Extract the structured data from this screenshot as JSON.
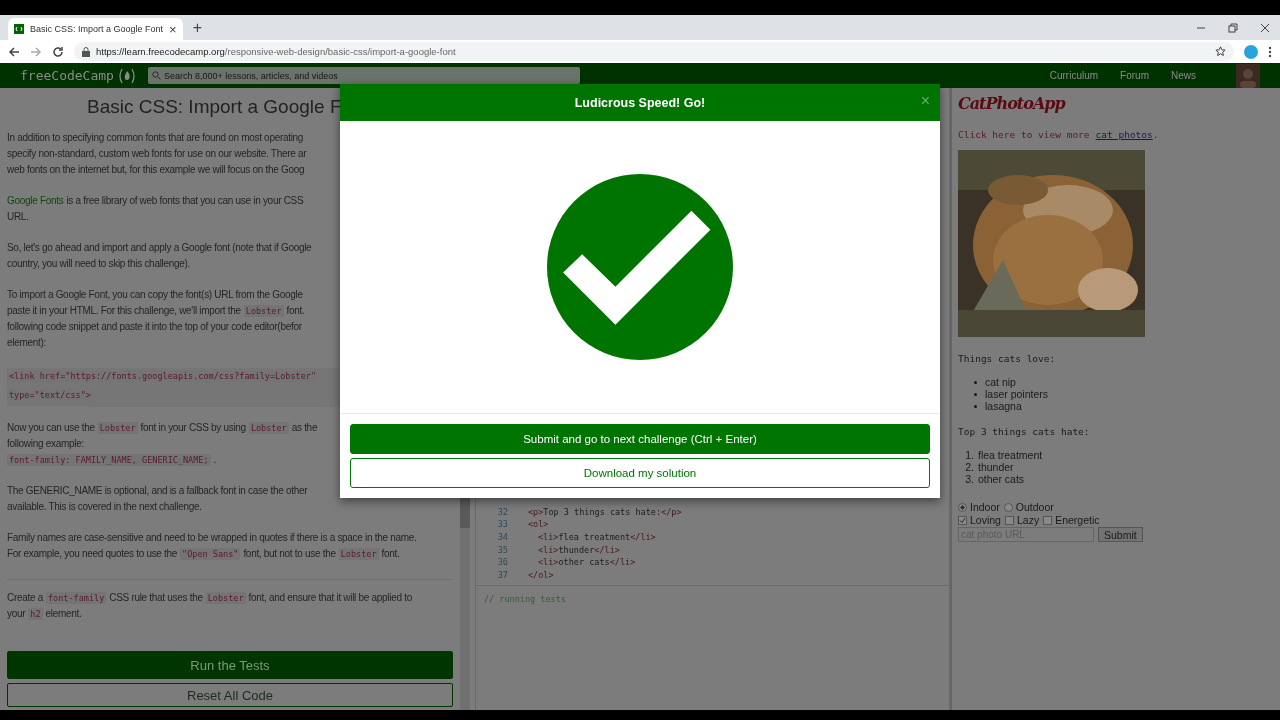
{
  "browser": {
    "tab_title": "Basic CSS: Import a Google Font",
    "tab_close": "×",
    "new_tab": "+",
    "url_host": "https://learn.freecodecamp.org",
    "url_path": "/responsive-web-design/basic-css/import-a-google-font"
  },
  "nav": {
    "logo": "freeCodeCamp",
    "search_placeholder": "Search 8,000+ lessons, articles, and videos",
    "links": [
      "Curriculum",
      "Forum",
      "News"
    ]
  },
  "lesson": {
    "title": "Basic CSS: Import a Google F",
    "paragraphs": [
      {
        "kind": "text",
        "lines": [
          [
            {
              "kind": "text",
              "text": "In addition to specifying common fonts that are found on most operating"
            }
          ],
          [
            {
              "kind": "text",
              "text": "specify non-standard, custom web fonts for use on our website. There ar"
            }
          ],
          [
            {
              "kind": "text",
              "text": "web fonts on the internet but, for this example we will focus on the Goog"
            }
          ]
        ]
      },
      {
        "kind": "text",
        "lines": [
          [
            {
              "kind": "link",
              "text": "Google Fonts"
            },
            {
              "kind": "text",
              "text": "is a free library of web fonts that you can use in your CSS"
            }
          ],
          [
            {
              "kind": "text",
              "text": "URL."
            }
          ]
        ]
      },
      {
        "kind": "text",
        "lines": [
          [
            {
              "kind": "text",
              "text": "So, let's go ahead and import and apply a Google font (note that if Google"
            }
          ],
          [
            {
              "kind": "text",
              "text": "country, you will need to skip this challenge)."
            }
          ]
        ]
      },
      {
        "kind": "text",
        "lines": [
          [
            {
              "kind": "text",
              "text": "To import a Google Font, you can copy the font(s) URL from the Google"
            }
          ],
          [
            {
              "kind": "text",
              "text": "paste it in your HTML. For this challenge, we'll import the"
            },
            {
              "kind": "code",
              "text": "Lobster"
            },
            {
              "kind": "text",
              "text": "font."
            }
          ],
          [
            {
              "kind": "text",
              "text": "following code snippet and paste it into the top of your code editor(befor"
            }
          ],
          [
            {
              "kind": "text",
              "text": "element):"
            }
          ]
        ]
      },
      {
        "kind": "code_block",
        "lines": [
          [
            {
              "kind": "code",
              "text": "<link href=\"https://fonts.googleapis.com/css?family=Lobster\""
            }
          ],
          [
            {
              "kind": "code",
              "text": "type=\"text/css\">"
            }
          ]
        ]
      },
      {
        "kind": "text",
        "lines": [
          [
            {
              "kind": "text",
              "text": "Now you can use the"
            },
            {
              "kind": "code",
              "text": "Lobster"
            },
            {
              "kind": "text",
              "text": "font in your CSS by using"
            },
            {
              "kind": "code",
              "text": "Lobster"
            },
            {
              "kind": "text",
              "text": "as the"
            }
          ],
          [
            {
              "kind": "text",
              "text": "following example:"
            }
          ],
          [
            {
              "kind": "code",
              "text": "font-family: FAMILY_NAME, GENERIC_NAME;"
            },
            {
              "kind": "text",
              "text": "."
            }
          ]
        ]
      },
      {
        "kind": "text",
        "lines": [
          [
            {
              "kind": "text",
              "text": "The GENERIC_NAME is optional, and is a fallback font in case the other"
            }
          ],
          [
            {
              "kind": "text",
              "text": "available. This is covered in the next challenge."
            }
          ]
        ]
      },
      {
        "kind": "text",
        "lines": [
          [
            {
              "kind": "text",
              "text": "Family names are case-sensitive and need to be wrapped in quotes if there is a space in the name."
            }
          ],
          [
            {
              "kind": "text",
              "text": "For example, you need quotes to use the"
            },
            {
              "kind": "code",
              "text": "\"Open Sans\""
            },
            {
              "kind": "text",
              "text": "font, but not to use the"
            },
            {
              "kind": "code",
              "text": "Lobster"
            },
            {
              "kind": "text",
              "text": "font."
            }
          ]
        ]
      },
      {
        "kind": "rule"
      },
      {
        "kind": "text",
        "lines": [
          [
            {
              "kind": "text",
              "text": "Create a"
            },
            {
              "kind": "code",
              "text": "font-family"
            },
            {
              "kind": "text",
              "text": "CSS rule that uses the"
            },
            {
              "kind": "code",
              "text": "Lobster"
            },
            {
              "kind": "text",
              "text": "font, and ensure that it will be applied to"
            }
          ],
          [
            {
              "kind": "text",
              "text": "your"
            },
            {
              "kind": "code",
              "text": "h2"
            },
            {
              "kind": "text",
              "text": "element."
            }
          ]
        ]
      }
    ],
    "buttons": [
      {
        "label": "Run the Tests",
        "kind": "primary"
      },
      {
        "label": "Reset All Code",
        "kind": "outline"
      }
    ]
  },
  "editor": {
    "lines": [
      {
        "number": "32",
        "segments": [
          {
            "kind": "tag",
            "text": "<p>"
          },
          {
            "kind": "text",
            "text": "Top 3 things cats hate:"
          },
          {
            "kind": "tag",
            "text": "</p>"
          }
        ]
      },
      {
        "number": "33",
        "segments": [
          {
            "kind": "tag",
            "text": "<ol>"
          }
        ],
        "children": [
          {
            "number": "34",
            "segments": [
              {
                "kind": "tag",
                "text": "<li>"
              },
              {
                "kind": "text",
                "text": "flea treatment"
              },
              {
                "kind": "tag",
                "text": "</li>"
              }
            ]
          },
          {
            "number": "35",
            "segments": [
              {
                "kind": "tag",
                "text": "<li>"
              },
              {
                "kind": "text",
                "text": "thunder"
              },
              {
                "kind": "tag",
                "text": "</li>"
              }
            ]
          },
          {
            "number": "36",
            "segments": [
              {
                "kind": "tag",
                "text": "<li>"
              },
              {
                "kind": "text",
                "text": "other cats"
              },
              {
                "kind": "tag",
                "text": "</li>"
              }
            ]
          }
        ]
      },
      {
        "number": "37",
        "segments": [
          {
            "kind": "tag",
            "text": "</ol>"
          }
        ]
      }
    ],
    "output": "// running tests"
  },
  "preview": {
    "title": "CatPhotoApp",
    "link_line": {
      "before": "Click here to view more",
      "link": "cat photos",
      "after": "."
    },
    "love_heading": "Things cats love:",
    "love": [
      "cat nip",
      "laser pointers",
      "lasagna"
    ],
    "hate_heading": "Top 3 things cats hate:",
    "hate": [
      {
        "number": "1.",
        "text": "flea treatment"
      },
      {
        "number": "2.",
        "text": "thunder"
      },
      {
        "number": "3.",
        "text": "other cats"
      }
    ],
    "radios": [
      {
        "label": "Indoor",
        "selected": true
      },
      {
        "label": "Outdoor",
        "selected": false
      }
    ],
    "checkboxes": [
      {
        "label": "Loving",
        "checked": true
      },
      {
        "label": "Lazy",
        "checked": false
      },
      {
        "label": "Energetic",
        "checked": false
      }
    ],
    "url_placeholder": "cat photo URL",
    "submit": "Submit"
  },
  "modal": {
    "title": "Ludicrous Speed! Go!",
    "close": "×",
    "buttons": [
      {
        "label": "Submit and go to next challenge (Ctrl + Enter)",
        "kind": "primary"
      },
      {
        "label": "Download my solution",
        "kind": "outline"
      }
    ]
  }
}
